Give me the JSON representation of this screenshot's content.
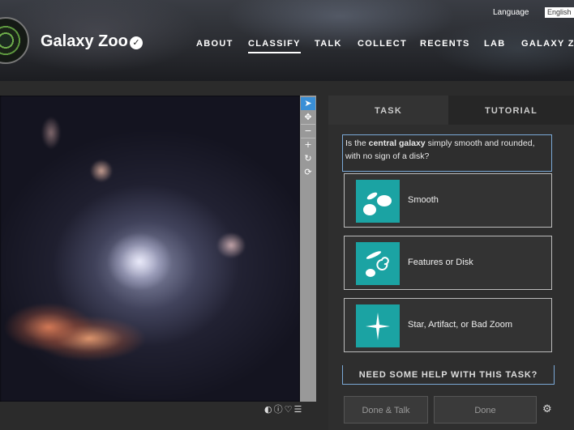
{
  "header": {
    "brand": "Galaxy Zoo",
    "language_label": "Language",
    "language_value": "English",
    "nav": [
      "ABOUT",
      "CLASSIFY",
      "TALK",
      "COLLECT",
      "RECENTS",
      "LAB",
      "GALAXY ZOO"
    ],
    "active_nav": "CLASSIFY"
  },
  "subject": {
    "toolbar_icons": [
      "pointer-icon",
      "pan-icon",
      "zoom-out-icon",
      "zoom-in-icon",
      "rotate-icon",
      "reset-icon"
    ],
    "meta_icons": [
      "invert-icon",
      "info-icon",
      "heart-icon",
      "collections-icon"
    ]
  },
  "panel": {
    "tabs": [
      "TASK",
      "TUTORIAL"
    ],
    "question_pre": "Is the ",
    "question_bold": "central galaxy",
    "question_post": " simply smooth and rounded, with no sign of a disk?",
    "answers": [
      {
        "label": "Smooth",
        "icon": "smooth-galaxy-icon"
      },
      {
        "label": "Features or Disk",
        "icon": "features-disk-icon"
      },
      {
        "label": "Star, Artifact, or Bad Zoom",
        "icon": "star-artifact-icon"
      }
    ],
    "help": "NEED SOME HELP WITH THIS TASK?",
    "done_talk": "Done & Talk",
    "done": "Done"
  },
  "colors": {
    "accent": "#1ba3a3",
    "focus": "#7aa8d6",
    "tool_active": "#3a8fd6"
  }
}
